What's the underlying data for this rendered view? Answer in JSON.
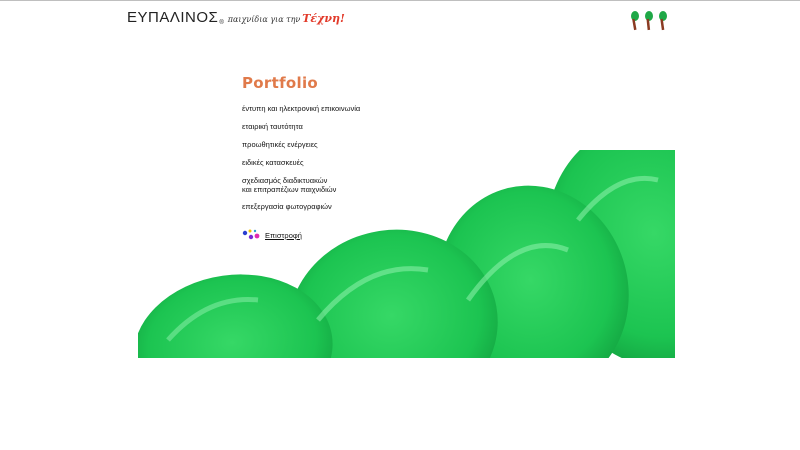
{
  "brand": {
    "name": "ΕΥΠΑΛΙΝΟΣ",
    "registered": "®",
    "tagline": "παιχνίδια για την",
    "accent": "Τέχνη!"
  },
  "page": {
    "title": "Portfolio"
  },
  "menu": {
    "items": [
      {
        "label": "έντυπη και ηλεκτρονική επικοινωνία"
      },
      {
        "label": "εταιρική ταυτότητα"
      },
      {
        "label": "προωθητικές ενέργειες"
      },
      {
        "label": "ειδικές κατασκευές"
      },
      {
        "label": "σχεδιασμός διαδικτυακών\nκαι επιτραπέζιων παιχνιδιών"
      },
      {
        "label": "επεξεργασία φωτογραφιών"
      }
    ]
  },
  "back": {
    "label": "Επιστροφή"
  },
  "icons": {
    "trees": "trees-icon",
    "back_dots": "colored-dots-icon"
  },
  "colors": {
    "title": "#e07a4a",
    "accent": "#e23a2a",
    "leaf_green": "#1fcf57",
    "leaf_dark": "#0fa83e",
    "tree_trunk": "#8a3b22"
  }
}
